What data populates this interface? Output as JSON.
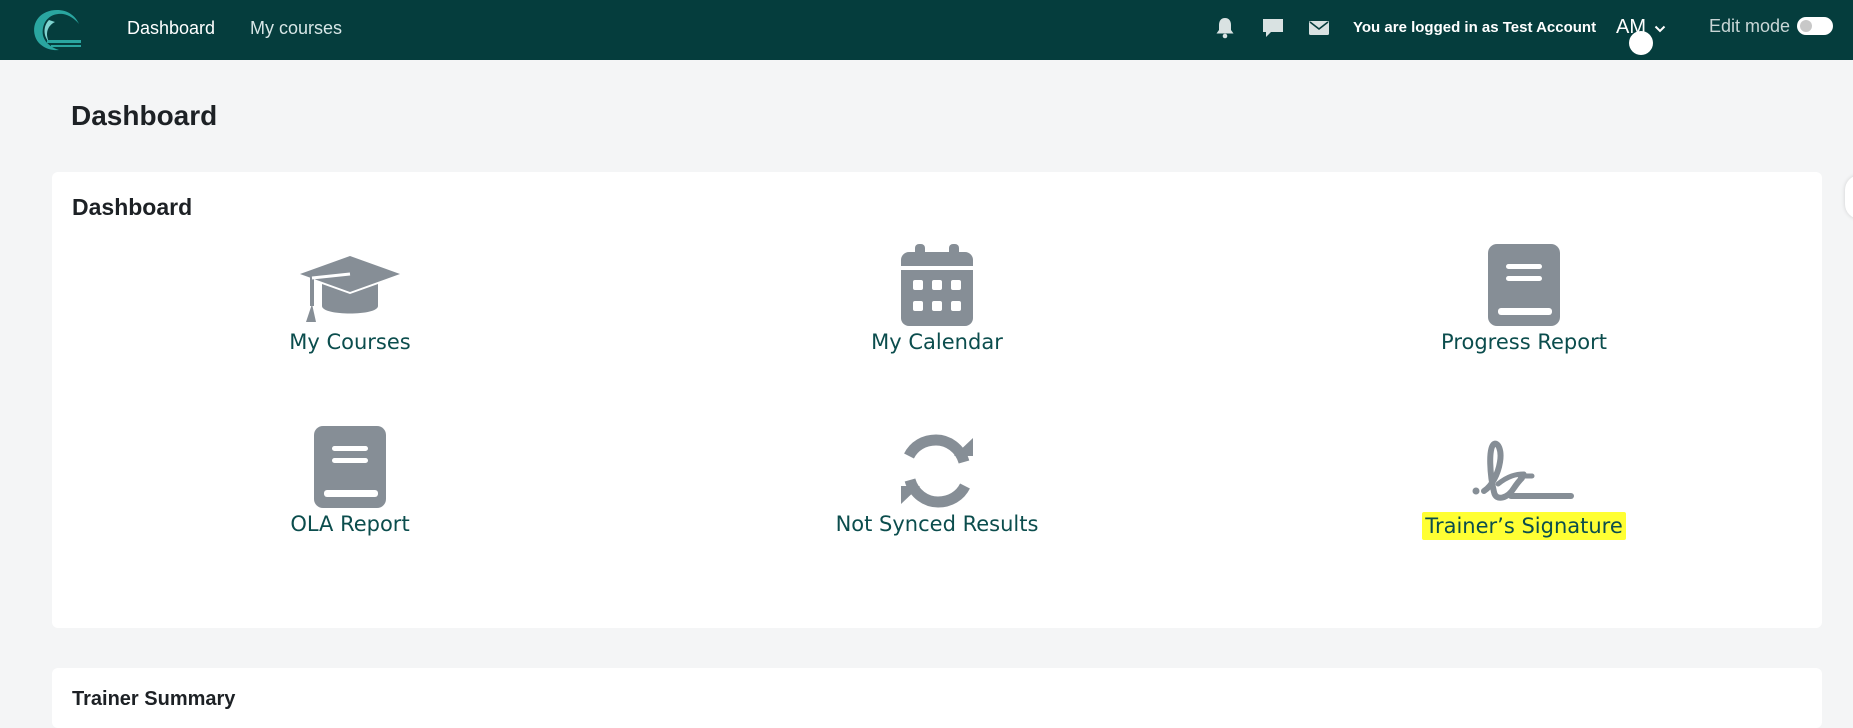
{
  "navbar": {
    "links": [
      {
        "label": "Dashboard",
        "active": true
      },
      {
        "label": "My courses",
        "active": false
      }
    ],
    "icons": [
      "bell-icon",
      "chat-icon",
      "mail-icon"
    ],
    "logged_in_text": "You are logged in as Test Account",
    "user_initials": "AM",
    "edit_mode_label": "Edit mode",
    "edit_mode_on": false,
    "background_color": "#053d3d"
  },
  "page": {
    "title": "Dashboard"
  },
  "dashboard_card": {
    "title": "Dashboard",
    "tiles": [
      {
        "label": "My Courses",
        "icon": "graduation-cap-icon"
      },
      {
        "label": "My Calendar",
        "icon": "calendar-icon"
      },
      {
        "label": "Progress Report",
        "icon": "book-icon"
      },
      {
        "label": "OLA Report",
        "icon": "book-icon"
      },
      {
        "label": "Not Synced Results",
        "icon": "sync-icon"
      },
      {
        "label": "Trainer’s Signature",
        "icon": "signature-icon",
        "highlighted": true
      }
    ],
    "icon_color": "#868e96",
    "label_color": "#0b4d4d",
    "highlight_color": "#ffff33"
  },
  "summary_card": {
    "title": "Trainer Summary"
  }
}
